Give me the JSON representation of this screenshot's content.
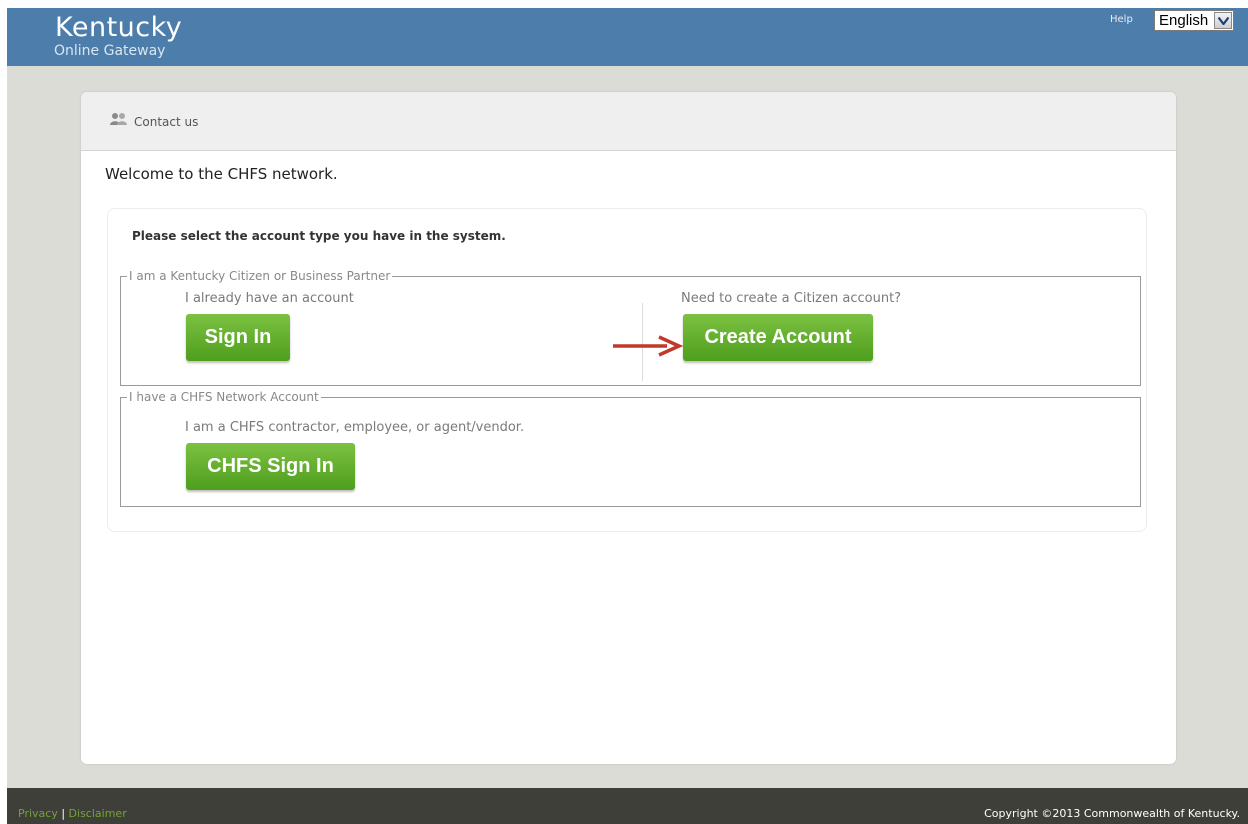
{
  "header": {
    "brand_title": "Kentucky",
    "brand_subtitle": "Online Gateway",
    "help_label": "Help",
    "language_selected": "English"
  },
  "nav": {
    "contact_label": "Contact us",
    "contact_icon": "people-icon"
  },
  "main": {
    "welcome": "Welcome to the CHFS network.",
    "prompt": "Please select the account type you have in the system.",
    "citizen_group": {
      "legend": "I am a Kentucky Citizen or Business Partner",
      "existing_label": "I already have an account",
      "sign_in_button": "Sign In",
      "create_label": "Need to create a Citizen account?",
      "create_button": "Create Account"
    },
    "chfs_group": {
      "legend": "I have a CHFS Network Account",
      "description": "I am a CHFS contractor, employee, or agent/vendor.",
      "sign_in_button": "CHFS Sign In"
    }
  },
  "footer": {
    "privacy": "Privacy",
    "separator": "|",
    "disclaimer": "Disclaimer",
    "copyright": "Copyright ©2013 Commonwealth of Kentucky."
  },
  "colors": {
    "header_bg": "#4d7eab",
    "button_green": "#5aa828",
    "annotation_arrow": "#c0392b",
    "footer_bg": "#3f3f3a",
    "footer_link": "#74a236"
  }
}
